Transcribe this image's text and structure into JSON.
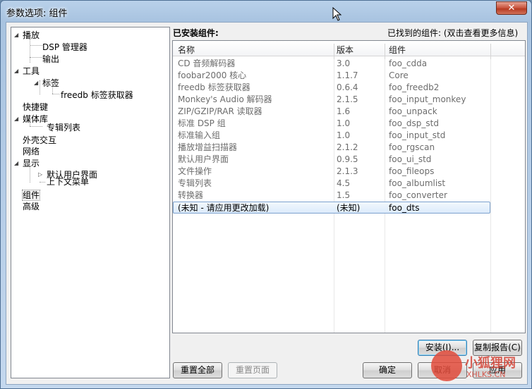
{
  "window": {
    "title": "参数选项: 组件",
    "close_glyph": "✕"
  },
  "tree": {
    "items": [
      {
        "label": "播放",
        "toggle": "◢"
      },
      {
        "label": "DSP 管理器"
      },
      {
        "label": "输出"
      },
      {
        "label": "工具",
        "toggle": "◢"
      },
      {
        "label": "标签",
        "toggle": "◢"
      },
      {
        "label": "freedb 标签获取器"
      },
      {
        "label": "快捷键"
      },
      {
        "label": "媒体库",
        "toggle": "◢"
      },
      {
        "label": "专辑列表"
      },
      {
        "label": "外壳交互"
      },
      {
        "label": "网络"
      },
      {
        "label": "显示",
        "toggle": "◢"
      },
      {
        "label": "默认用户界面",
        "toggle": "▷"
      },
      {
        "label": "上下文菜单"
      },
      {
        "label": "组件"
      },
      {
        "label": "高级"
      }
    ]
  },
  "components": {
    "header_left": "已安装组件:",
    "header_right": "已找到的组件:  (双击查看更多信息)",
    "columns": [
      "名称",
      "版本",
      "组件"
    ],
    "rows": [
      [
        "CD 音频解码器",
        "3.0",
        "foo_cdda"
      ],
      [
        "foobar2000 核心",
        "1.1.7",
        "Core"
      ],
      [
        "freedb 标签获取器",
        "0.6.4",
        "foo_freedb2"
      ],
      [
        "Monkey's Audio 解码器",
        "2.1.5",
        "foo_input_monkey"
      ],
      [
        "ZIP/GZIP/RAR 读取器",
        "1.6",
        "foo_unpack"
      ],
      [
        "标准 DSP 组",
        "1.0",
        "foo_dsp_std"
      ],
      [
        "标准输入组",
        "1.0",
        "foo_input_std"
      ],
      [
        "播放增益扫描器",
        "2.1.2",
        "foo_rgscan"
      ],
      [
        "默认用户界面",
        "0.9.5",
        "foo_ui_std"
      ],
      [
        "文件操作",
        "2.1.3",
        "foo_fileops"
      ],
      [
        "专辑列表",
        "4.5",
        "foo_albumlist"
      ],
      [
        "转换器",
        "1.5",
        "foo_converter"
      ],
      [
        "(未知 - 请应用更改加载)",
        "(未知)",
        "foo_dts"
      ]
    ]
  },
  "buttons": {
    "install": "安装(I)...",
    "copy_report": "复制报告(C)",
    "reset_all": "重置全部",
    "reset_page": "重置页面",
    "ok": "确定",
    "cancel": "取消",
    "apply": "应用"
  },
  "watermark": {
    "text": "小狐狸网",
    "sub": "XHLKS.CN"
  }
}
